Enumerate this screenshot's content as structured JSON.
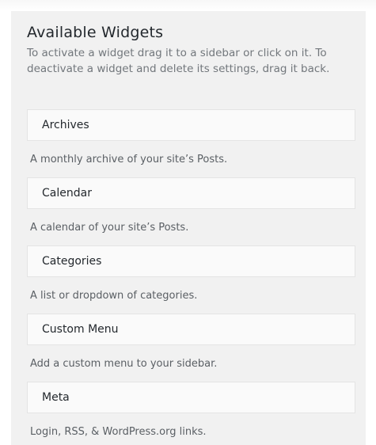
{
  "panel": {
    "title": "Available Widgets",
    "description": "To activate a widget drag it to a sidebar or click on it. To deactivate a widget and delete its settings, drag it back."
  },
  "widgets": [
    {
      "name": "Archives",
      "description": "A monthly archive of your site’s Posts."
    },
    {
      "name": "Calendar",
      "description": "A calendar of your site’s Posts."
    },
    {
      "name": "Categories",
      "description": "A list or dropdown of categories."
    },
    {
      "name": "Custom Menu",
      "description": "Add a custom menu to your sidebar."
    },
    {
      "name": "Meta",
      "description": "Login, RSS, & WordPress.org links."
    }
  ]
}
